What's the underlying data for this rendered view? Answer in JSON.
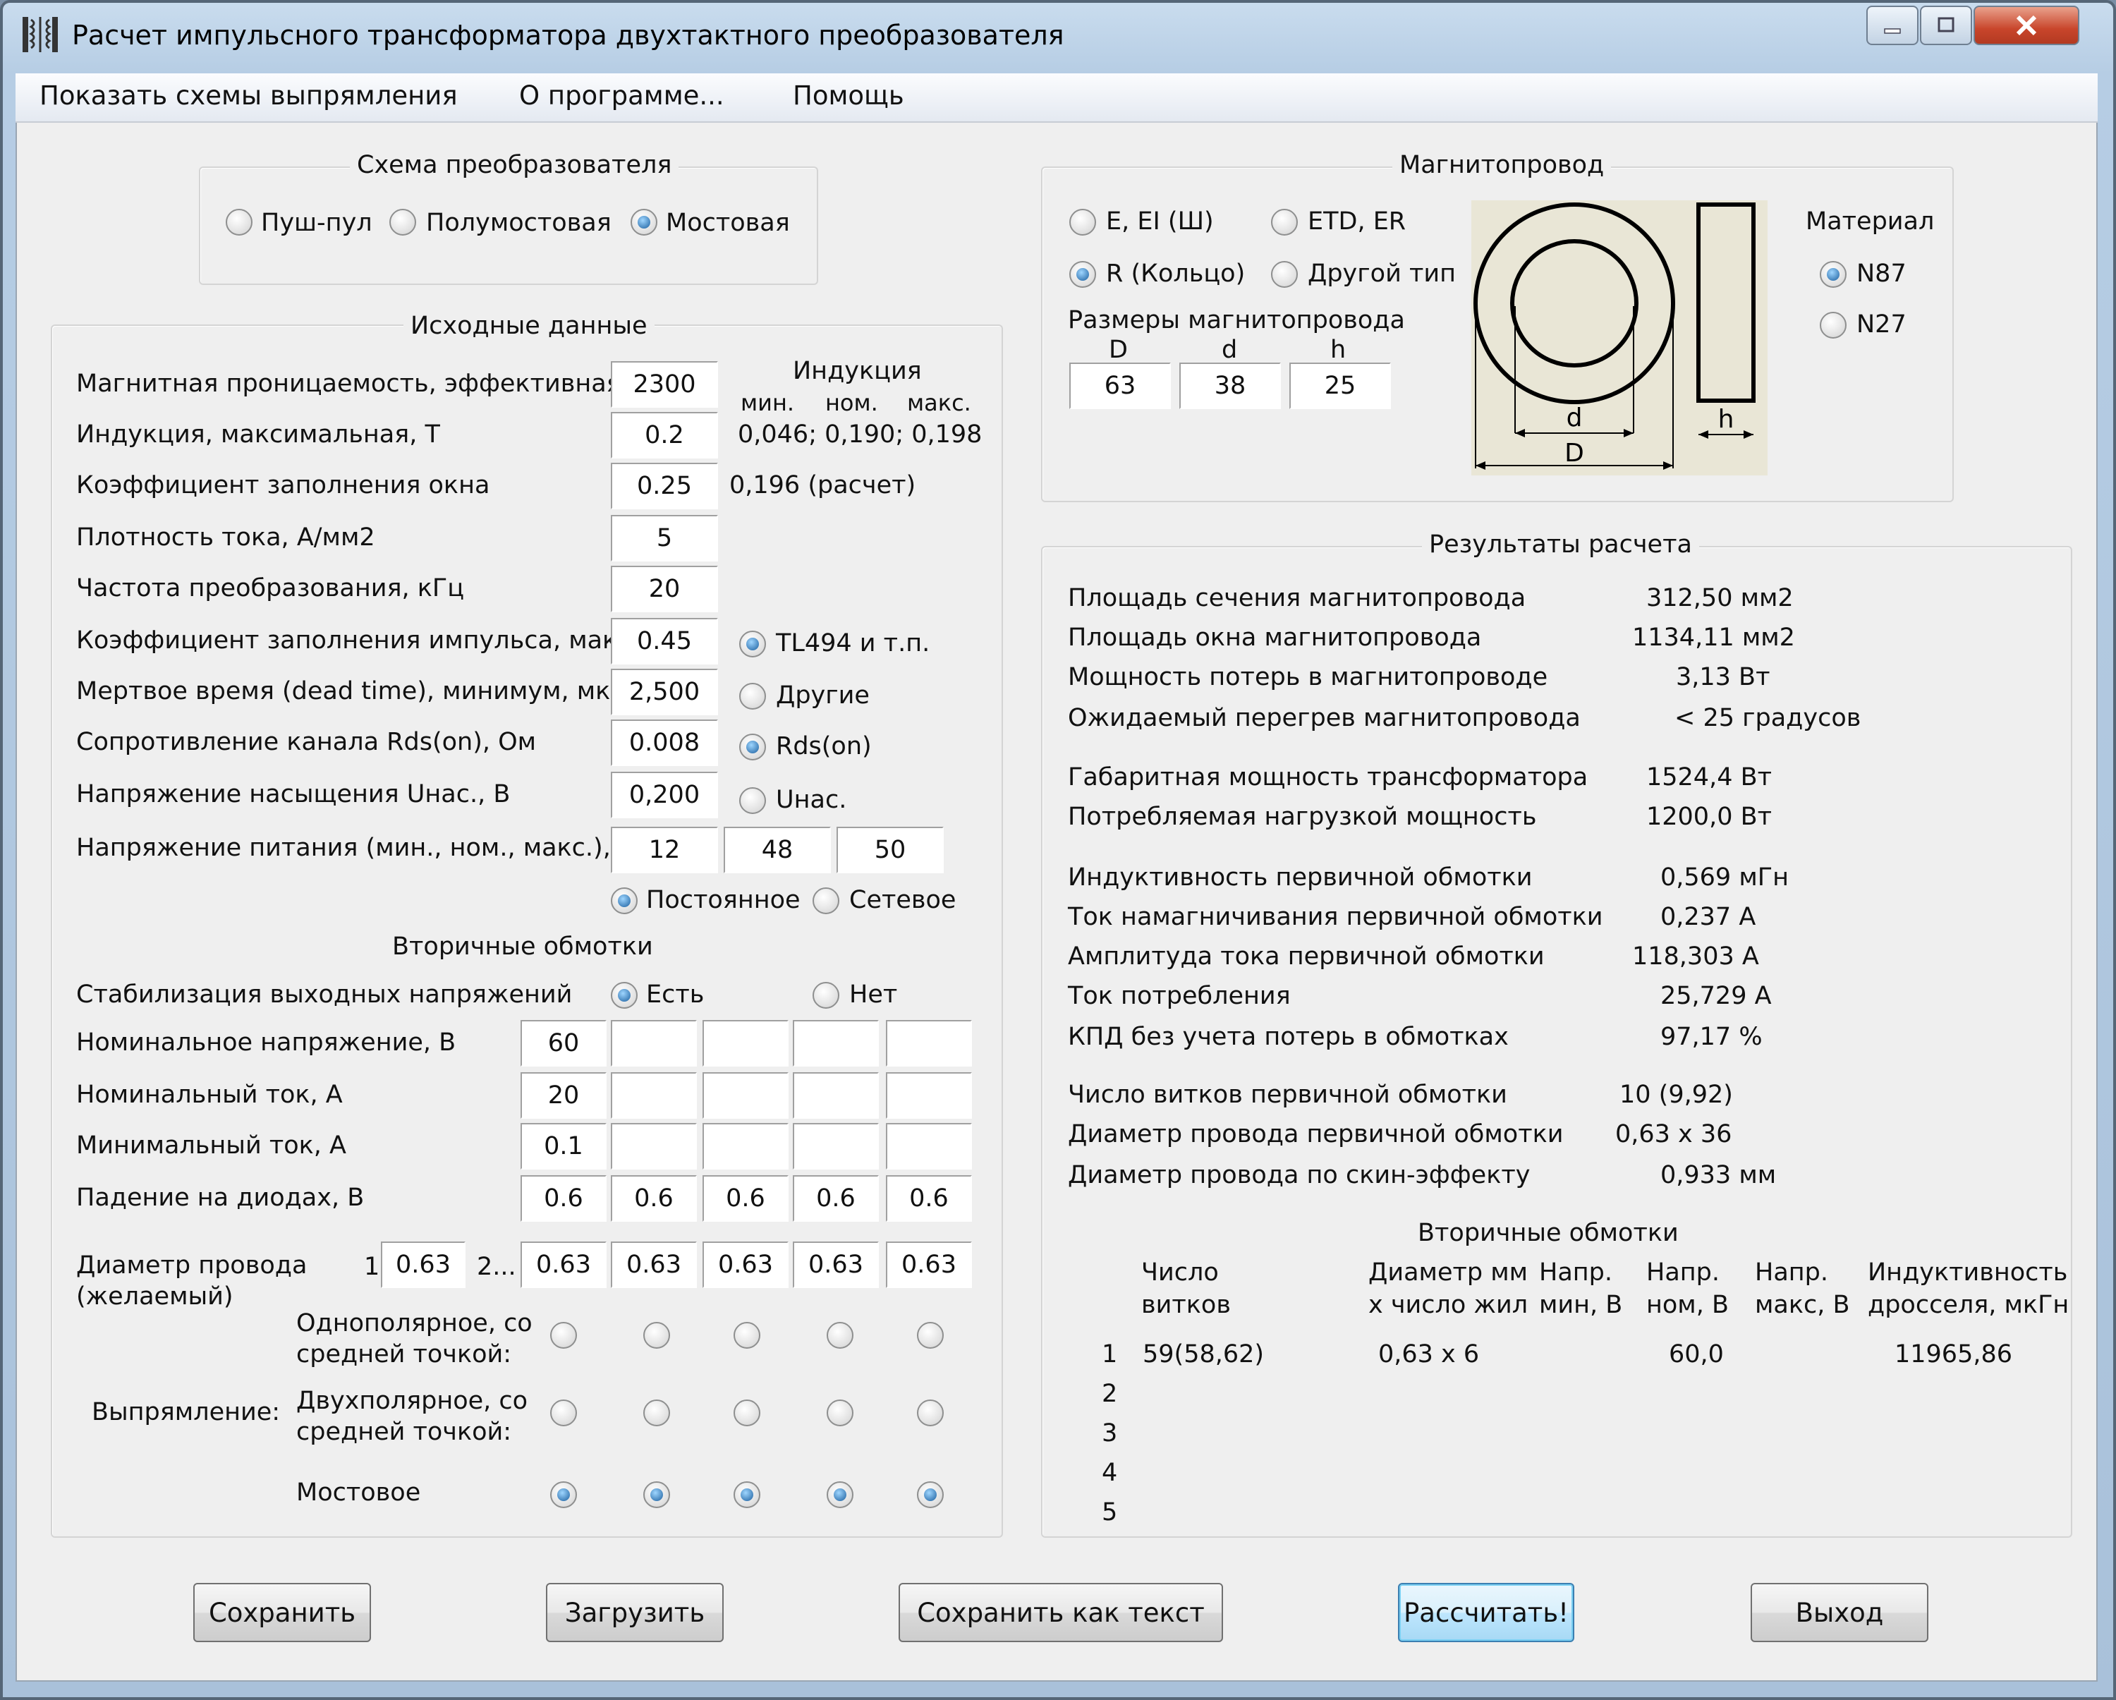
{
  "window": {
    "title": "Расчет импульсного трансформатора двухтактного преобразователя"
  },
  "menu": [
    "Показать схемы выпрямления",
    "О программе...",
    "Помощь"
  ],
  "converter": {
    "title": "Схема преобразователя",
    "options": [
      "Пуш-пул",
      "Полумостовая",
      "Мостовая"
    ],
    "selected": "Мостовая"
  },
  "input": {
    "title": "Исходные данные",
    "fields": [
      {
        "label": "Магнитная проницаемость, эффективная",
        "value": "2300"
      },
      {
        "label": "Индукция, максимальная, Т",
        "value": "0.2"
      },
      {
        "label": "Коэффициент заполнения окна",
        "value": "0.25"
      },
      {
        "label": "Плотность тока, А/мм2",
        "value": "5"
      },
      {
        "label": "Частота преобразования, кГц",
        "value": "20"
      },
      {
        "label": "Коэффициент заполнения импульса, макс.",
        "value": "0.45"
      },
      {
        "label": "Мертвое время (dead time), минимум, мкс",
        "value": "2,500"
      },
      {
        "label": "Сопротивление канала Rds(on), Ом",
        "value": "0.008"
      },
      {
        "label": "Напряжение насыщения Uнас., В",
        "value": "0,200"
      }
    ],
    "supply_label": "Напряжение питания (мин., ном., макс.),",
    "supply_values": [
      "12",
      "48",
      "50"
    ],
    "induction_header": "Индукция",
    "induction_sub": [
      "мин.",
      "ном.",
      "макс."
    ],
    "induction_values": "0,046; 0,190; 0,198",
    "fill_calc": "0,196 (расчет)",
    "controller": {
      "options": [
        "TL494 и т.п.",
        "Другие"
      ],
      "selected": "TL494 и т.п."
    },
    "switch": {
      "options": [
        "Rds(on)",
        "Uнас."
      ],
      "selected": "Rds(on)"
    },
    "supply_type": {
      "options": [
        "Постоянное",
        "Сетевое"
      ],
      "selected": "Постоянное"
    }
  },
  "secondary": {
    "title": "Вторичные обмотки",
    "stab_label": "Стабилизация выходных напряжений",
    "stab_options": [
      "Есть",
      "Нет"
    ],
    "stab_selected": "Есть",
    "rows": [
      {
        "label": "Номинальное напряжение, В",
        "values": [
          "60",
          "",
          "",
          "",
          ""
        ]
      },
      {
        "label": "Номинальный ток, А",
        "values": [
          "20",
          "",
          "",
          "",
          ""
        ]
      },
      {
        "label": "Минимальный ток, А",
        "values": [
          "0.1",
          "",
          "",
          "",
          ""
        ]
      },
      {
        "label": "Падение на диодах, В",
        "values": [
          "0.6",
          "0.6",
          "0.6",
          "0.6",
          "0.6"
        ]
      }
    ],
    "wire_label_1": "Диаметр провода",
    "wire_label_2": "(желаемый)",
    "wire_prefix_1": "1",
    "wire_primary": "0.63",
    "wire_prefix_2": "2...",
    "wire_values": [
      "0.63",
      "0.63",
      "0.63",
      "0.63",
      "0.63"
    ],
    "rect_label": "Выпрямление:",
    "rect_options": [
      {
        "label": [
          "Однополярное, со",
          "средней точкой:"
        ],
        "selected": [
          false,
          false,
          false,
          false,
          false
        ]
      },
      {
        "label": [
          "Двухполярное, со",
          "средней точкой:"
        ],
        "selected": [
          false,
          false,
          false,
          false,
          false
        ]
      },
      {
        "label": [
          "Мостовое"
        ],
        "selected": [
          true,
          true,
          true,
          true,
          true
        ]
      }
    ]
  },
  "core": {
    "title": "Магнитопровод",
    "types": [
      "E, EI (Ш)",
      "ETD, ER",
      "R (Кольцо)",
      "Другой тип"
    ],
    "selected_type": "R (Кольцо)",
    "dims_title": "Размеры магнитопровода",
    "dims": [
      {
        "name": "D",
        "value": "63"
      },
      {
        "name": "d",
        "value": "38"
      },
      {
        "name": "h",
        "value": "25"
      }
    ],
    "material_title": "Материал",
    "materials": [
      "N87",
      "N27"
    ],
    "selected_material": "N87",
    "diagram_labels": {
      "d": "d",
      "D": "D",
      "h": "h"
    }
  },
  "results": {
    "title": "Результаты расчета",
    "groups": [
      [
        {
          "label": "Площадь сечения магнитопровода",
          "value": "312,50 мм2"
        },
        {
          "label": "Площадь окна магнитопровода",
          "value": "1134,11 мм2"
        },
        {
          "label": "Мощность потерь в магнитопроводе",
          "value": "3,13 Вт"
        },
        {
          "label": "Ожидаемый перегрев магнитопровода",
          "value": "< 25 градусов"
        }
      ],
      [
        {
          "label": "Габаритная мощность трансформатора",
          "value": "1524,4 Вт"
        },
        {
          "label": "Потребляемая нагрузкой мощность",
          "value": "1200,0 Вт"
        }
      ],
      [
        {
          "label": "Индуктивность первичной обмотки",
          "value": "0,569 мГн"
        },
        {
          "label": "Ток намагничивания первичной обмотки",
          "value": "0,237 А"
        },
        {
          "label": "Амплитуда тока первичной обмотки",
          "value": "118,303 А"
        },
        {
          "label": "Ток потребления",
          "value": "25,729 А"
        },
        {
          "label": "КПД без учета потерь в обмотках",
          "value": "97,17 %"
        }
      ],
      [
        {
          "label": "Число витков первичной обмотки",
          "value": "10 (9,92)"
        },
        {
          "label": "Диаметр провода первичной обмотки",
          "value": "0,63 x 36"
        },
        {
          "label": "Диаметр провода по скин-эффекту",
          "value": "0,933 мм"
        }
      ]
    ],
    "secondary_title": "Вторичные обмотки",
    "table_headers": [
      [
        "Число",
        "витков"
      ],
      [
        "Диаметр мм",
        "x число жил"
      ],
      [
        "Напр.",
        "мин, В"
      ],
      [
        "Напр.",
        "ном, В"
      ],
      [
        "Напр.",
        "макс, В"
      ],
      [
        "Индуктивность",
        "дросселя, мкГн"
      ]
    ],
    "table_rows": [
      {
        "n": "1",
        "turns": "59(58,62)",
        "wire": "0,63 x 6",
        "vmin": "",
        "vnom": "60,0",
        "vmax": "",
        "ind": "11965,86"
      },
      {
        "n": "2",
        "turns": "",
        "wire": "",
        "vmin": "",
        "vnom": "",
        "vmax": "",
        "ind": ""
      },
      {
        "n": "3",
        "turns": "",
        "wire": "",
        "vmin": "",
        "vnom": "",
        "vmax": "",
        "ind": ""
      },
      {
        "n": "4",
        "turns": "",
        "wire": "",
        "vmin": "",
        "vnom": "",
        "vmax": "",
        "ind": ""
      },
      {
        "n": "5",
        "turns": "",
        "wire": "",
        "vmin": "",
        "vnom": "",
        "vmax": "",
        "ind": ""
      }
    ]
  },
  "buttons": [
    "Сохранить",
    "Загрузить",
    "Сохранить как текст",
    "Рассчитать!",
    "Выход"
  ],
  "colors": {
    "radio_dot": "#1a5e9e",
    "window_frame": "#b6cde4",
    "close_button": "#c8452b"
  }
}
